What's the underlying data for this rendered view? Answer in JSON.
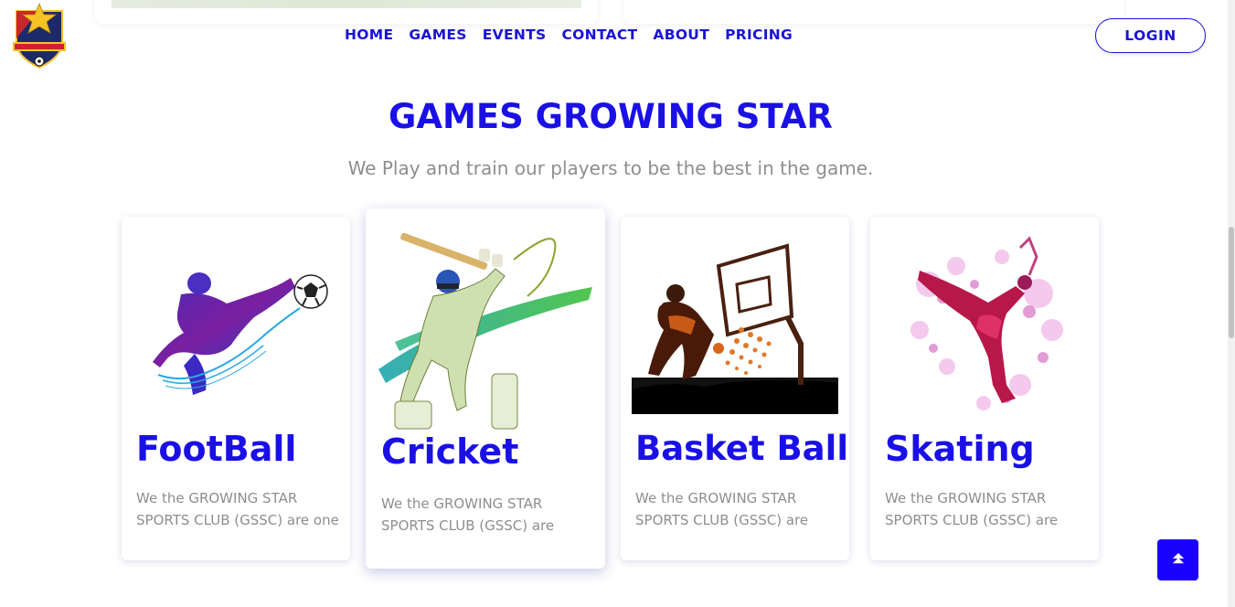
{
  "header": {
    "nav": [
      "HOME",
      "GAMES",
      "EVENTS",
      "CONTACT",
      "ABOUT",
      "PRICING"
    ],
    "login_label": "LOGIN"
  },
  "section": {
    "title": "GAMES GROWING STAR",
    "subtitle": "We Play and train our players to be the best in the game."
  },
  "cards": [
    {
      "title": "FootBall",
      "text": "We the GROWING STAR SPORTS CLUB (GSSC) are one",
      "image": "football-player"
    },
    {
      "title": "Cricket",
      "text": "We the GROWING STAR SPORTS CLUB (GSSC) are",
      "image": "cricket-player"
    },
    {
      "title": "Basket Ball",
      "text": "We the GROWING STAR SPORTS CLUB (GSSC) are",
      "image": "basketball-player"
    },
    {
      "title": "Skating",
      "text": "We the GROWING STAR SPORTS CLUB (GSSC) are",
      "image": "skater"
    }
  ],
  "icons": {
    "scroll_top": "double-chevron-up-icon",
    "logo": "club-shield-logo"
  },
  "colors": {
    "accent": "#1a10e6",
    "muted_text": "#8e8e8e",
    "button": "#1a00ff"
  }
}
